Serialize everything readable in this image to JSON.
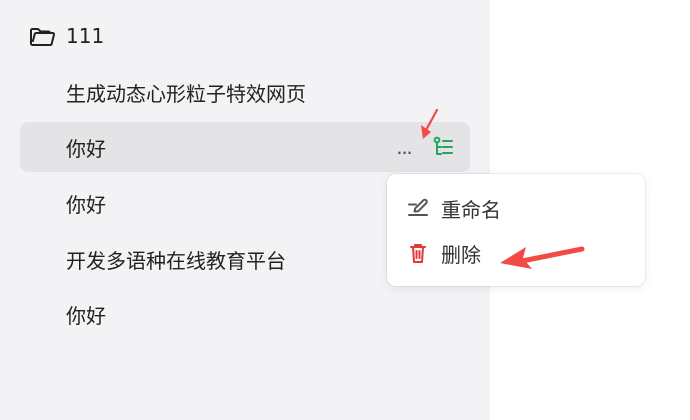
{
  "sidebar": {
    "folder": {
      "label": "111",
      "icon": "folder-open-icon"
    },
    "items": [
      {
        "label": "生成动态心形粒子特效网页",
        "active": false
      },
      {
        "label": "你好",
        "active": true
      },
      {
        "label": "你好",
        "active": false
      },
      {
        "label": "开发多语种在线教育平台",
        "active": false
      },
      {
        "label": "你好",
        "active": false
      }
    ],
    "active_item_actions": {
      "more_label": "...",
      "more_icon": "more-icon",
      "tree_icon": "tree-icon"
    }
  },
  "context_menu": {
    "items": [
      {
        "label": "重命名",
        "icon": "edit-icon"
      },
      {
        "label": "删除",
        "icon": "trash-icon"
      }
    ]
  },
  "colors": {
    "sidebar_background": "#f3f3f6",
    "active_item_background": "#e4e4e7",
    "green_icon": "#22a55b",
    "delete_icon": "#e53935",
    "annotation_red": "#f24b45"
  }
}
